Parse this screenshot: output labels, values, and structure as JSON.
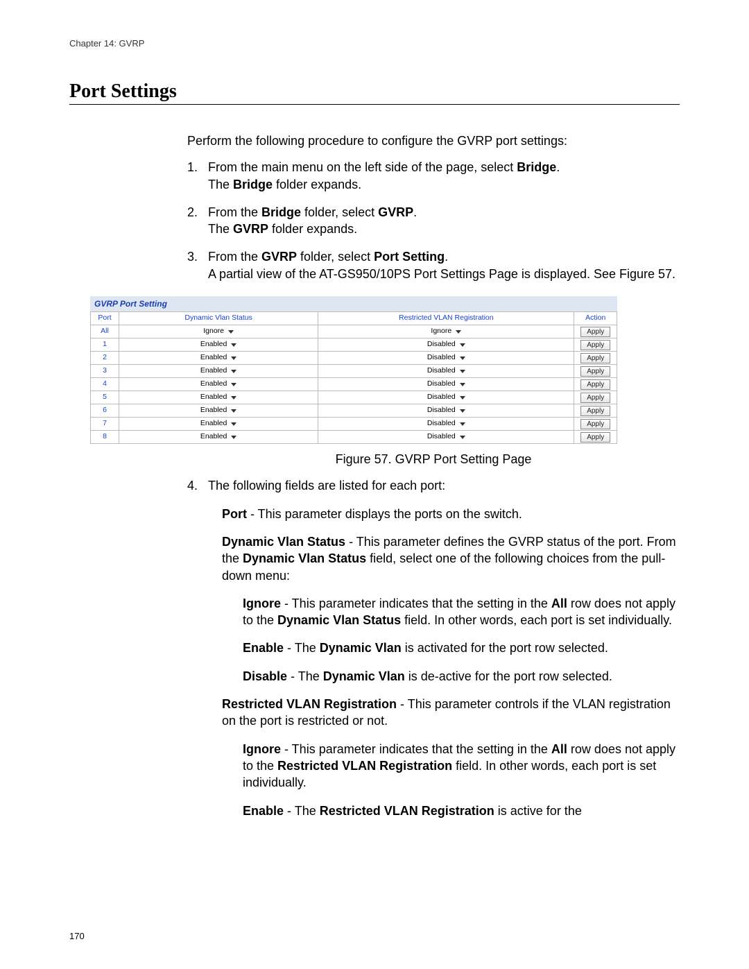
{
  "header": {
    "chapter": "Chapter 14: GVRP"
  },
  "title": "Port Settings",
  "intro": "Perform the following procedure to configure the GVRP port settings:",
  "steps": {
    "s1": {
      "num": "1.",
      "line1_pre": "From the main menu on the left side of the page, select ",
      "line1_bold": "Bridge",
      "line1_post": ".",
      "line2_pre": "The ",
      "line2_bold": "Bridge",
      "line2_post": " folder expands."
    },
    "s2": {
      "num": "2.",
      "line1_pre": "From the ",
      "line1_bold": "Bridge",
      "line1_mid": " folder, select ",
      "line1_bold2": "GVRP",
      "line1_post": ".",
      "line2_pre": "The ",
      "line2_bold": "GVRP",
      "line2_post": " folder expands."
    },
    "s3": {
      "num": "3.",
      "line1_pre": "From the ",
      "line1_bold": "GVRP",
      "line1_mid": " folder, select ",
      "line1_bold2": "Port Setting",
      "line1_post": ".",
      "line2": "A partial view of the AT-GS950/10PS Port Settings Page is displayed. See Figure 57."
    },
    "s4": {
      "num": "4.",
      "line1": "The following fields are listed for each port:"
    }
  },
  "table": {
    "title": "GVRP Port Setting",
    "headers": {
      "port": "Port",
      "dvs": "Dynamic Vlan Status",
      "rvr": "Restricted VLAN Registration",
      "action": "Action"
    },
    "rows": [
      {
        "port": "All",
        "dvs": "Ignore",
        "rvr": "Ignore",
        "action": "Apply"
      },
      {
        "port": "1",
        "dvs": "Enabled",
        "rvr": "Disabled",
        "action": "Apply"
      },
      {
        "port": "2",
        "dvs": "Enabled",
        "rvr": "Disabled",
        "action": "Apply"
      },
      {
        "port": "3",
        "dvs": "Enabled",
        "rvr": "Disabled",
        "action": "Apply"
      },
      {
        "port": "4",
        "dvs": "Enabled",
        "rvr": "Disabled",
        "action": "Apply"
      },
      {
        "port": "5",
        "dvs": "Enabled",
        "rvr": "Disabled",
        "action": "Apply"
      },
      {
        "port": "6",
        "dvs": "Enabled",
        "rvr": "Disabled",
        "action": "Apply"
      },
      {
        "port": "7",
        "dvs": "Enabled",
        "rvr": "Disabled",
        "action": "Apply"
      },
      {
        "port": "8",
        "dvs": "Enabled",
        "rvr": "Disabled",
        "action": "Apply"
      }
    ]
  },
  "figure_caption": "Figure 57. GVRP Port Setting Page",
  "fields": {
    "port": {
      "label": "Port",
      "text": " - This parameter displays the ports on the switch."
    },
    "dvs": {
      "label": "Dynamic Vlan Status",
      "text_pre": " - This parameter defines the GVRP status of the port. From the ",
      "text_bold": "Dynamic Vlan Status",
      "text_post": " field, select one of the following choices from the pull-down menu:"
    },
    "dvs_ignore": {
      "label": "Ignore",
      "text_pre": " - This parameter indicates that the setting in the ",
      "text_bold": "All",
      "text_mid": " row does not apply to the ",
      "text_bold2": "Dynamic Vlan Status",
      "text_post": " field. In other words, each port is set individually."
    },
    "dvs_enable": {
      "label": "Enable",
      "text_pre": " - The ",
      "text_bold": "Dynamic Vlan",
      "text_post": " is activated for the port row selected."
    },
    "dvs_disable": {
      "label": "Disable",
      "text_pre": " - The ",
      "text_bold": "Dynamic Vlan",
      "text_post": " is de-active for the port row selected."
    },
    "rvr": {
      "label": "Restricted VLAN Registration",
      "text": " - This parameter controls if the VLAN registration on the port is restricted or not."
    },
    "rvr_ignore": {
      "label": "Ignore",
      "text_pre": " - This parameter indicates that the setting in the ",
      "text_bold": "All",
      "text_mid": " row does not apply to the ",
      "text_bold2": "Restricted VLAN Registration",
      "text_post": " field. In other words, each port is set individually."
    },
    "rvr_enable": {
      "label": "Enable",
      "text_pre": " - The ",
      "text_bold": "Restricted VLAN Registration",
      "text_post": " is active for the"
    }
  },
  "page_number": "170"
}
